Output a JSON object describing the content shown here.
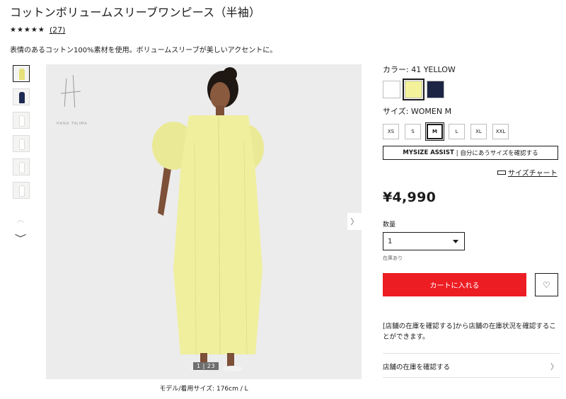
{
  "product": {
    "title": "コットンボリュームスリーブワンピース（半袖）",
    "stars": "★★★★★",
    "review_count": "(27)",
    "description": "表情のあるコットン100%素材を使用。ボリュームスリーブが美しいアクセントに。"
  },
  "gallery": {
    "thumbnail_colors": [
      "#f0ec9a",
      "#1e2a52",
      "#f3f3f3",
      "#f3f3f3",
      "#f3f3f3",
      "#f3f3f3"
    ],
    "logo_text": "HANA TAJIMA",
    "counter": "1 | 23",
    "model_caption": "モデル/着用サイズ: 176cm / L",
    "icons": {
      "up": "chevron-up-icon",
      "down": "chevron-down-icon",
      "next": "chevron-right-icon"
    }
  },
  "options": {
    "color_label": "カラー:  41 YELLOW",
    "colors": [
      {
        "name": "white",
        "hex": "#ffffff"
      },
      {
        "name": "yellow",
        "hex": "#f3f29b"
      },
      {
        "name": "navy",
        "hex": "#1c2544"
      }
    ],
    "selected_color_index": 1,
    "size_label": "サイズ:  WOMEN M",
    "sizes": [
      "XS",
      "S",
      "M",
      "L",
      "XL",
      "XXL"
    ],
    "selected_size_index": 2,
    "mysize_bold": "MYSIZE ASSIST",
    "mysize_rest": "|  自分にあうサイズを確認する",
    "size_chart": "サイズチャート"
  },
  "purchase": {
    "price": "¥4,990",
    "quantity_label": "数量",
    "quantity_value": "1",
    "stock_status": "在庫あり",
    "cart_button": "カートに入れる",
    "accent_color": "#ed1d24",
    "favorite_icon": "heart-icon",
    "store_note": "[店舗の在庫を確認する]から店舗の在庫状況を確認することができます。",
    "store_link": "店舗の在庫を確認する"
  }
}
